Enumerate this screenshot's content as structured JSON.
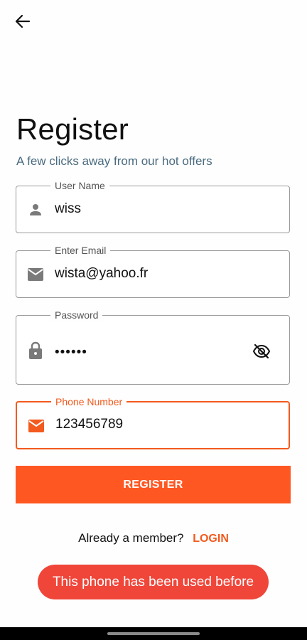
{
  "header": {
    "back_icon": "arrow-left-icon",
    "title": "Register",
    "subtitle": "A few clicks away from our hot offers"
  },
  "form": {
    "username": {
      "label": "User Name",
      "value": "wiss",
      "icon": "person-icon"
    },
    "email": {
      "label": "Enter Email",
      "value": "wista@yahoo.fr",
      "icon": "mail-icon"
    },
    "password": {
      "label": "Password",
      "value": "••••••",
      "icon": "lock-icon",
      "toggle_icon": "eye-off-icon"
    },
    "phone": {
      "label": "Phone Number",
      "value": "123456789",
      "icon": "mail-icon",
      "focused": true
    }
  },
  "actions": {
    "register_label": "REGISTER",
    "member_prompt": "Already a member?",
    "login_label": "LOGIN"
  },
  "toast": {
    "message": "This phone has been used before"
  },
  "colors": {
    "accent": "#ff5722",
    "subtitle": "#4a6b7f",
    "toast": "#f0463a",
    "border": "#9a9a9a"
  }
}
